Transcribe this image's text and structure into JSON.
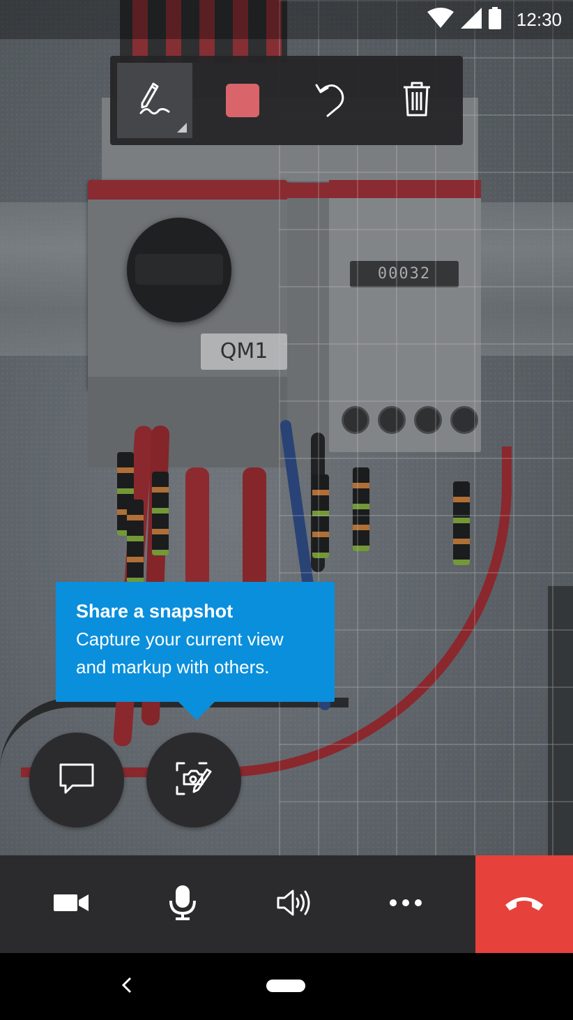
{
  "status_bar": {
    "time": "12:30",
    "icons": [
      "wifi-icon",
      "cellular-signal-icon",
      "battery-icon"
    ]
  },
  "camera": {
    "device_label": "QM1",
    "meter_reading": "00032"
  },
  "ink_toolbar": {
    "tools": [
      "pen-icon",
      "color-swatch",
      "undo-icon",
      "trash-icon"
    ],
    "selected_tool": "pen-icon",
    "ink_color": "#d9646a"
  },
  "tooltip": {
    "title": "Share a snapshot",
    "line1": "Capture your current view",
    "line2": "and markup with others.",
    "color": "#0a8fdc"
  },
  "floating_buttons": [
    "chat-icon",
    "snapshot-markup-icon"
  ],
  "call_controls": {
    "buttons": [
      "video-camera-icon",
      "microphone-icon",
      "speaker-icon",
      "more-icon"
    ],
    "end_call_color": "#e7413b"
  },
  "nav_bar": [
    "back-icon",
    "home-pill"
  ]
}
